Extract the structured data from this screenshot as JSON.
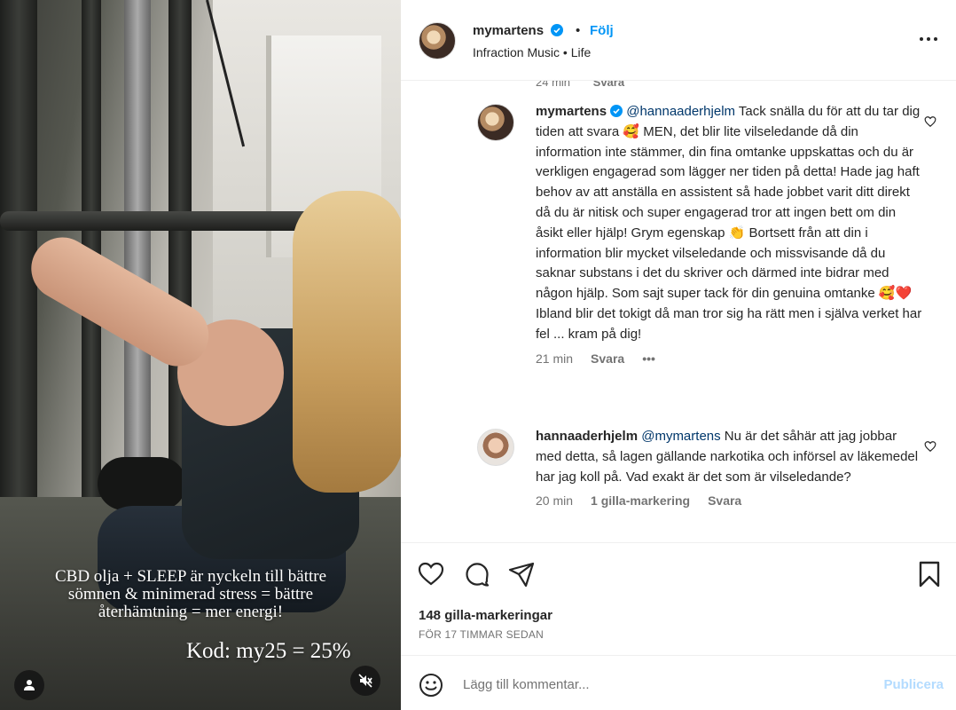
{
  "media": {
    "caption_lines": [
      "CBD olja + SLEEP är nyckeln till bättre",
      "sömnen & minimerad stress = bättre",
      "återhämtning = mer energi!"
    ],
    "code": "Kod: my25 = 25%"
  },
  "header": {
    "username": "mymartens",
    "separator": "•",
    "follow_label": "Följ",
    "subline": "Infraction Music • Life"
  },
  "partial_comment": {
    "time": "24 min",
    "reply_label": "Svara"
  },
  "comments": [
    {
      "username": "mymartens",
      "mention": "@hannaaderhjelm",
      "text_1": " Tack snälla du för att du tar dig tiden att svara ",
      "emoji_1": "🥰",
      "text_2": " MEN, det blir lite vilseledande då din information inte stämmer, din fina omtanke uppskattas och du är verkligen engagerad som lägger ner tiden på detta! Hade jag haft behov av att anställa en assistent så hade jobbet varit ditt direkt då du är nitisk och super engagerad tror att ingen bett om din åsikt eller hjälp! Grym egenskap ",
      "emoji_2": "👏",
      "text_3": " Bortsett från att din i information blir mycket vilseledande och missvisande då du saknar substans i det du skriver och därmed inte bidrar med någon hjälp. Som sajt super tack för din genuina omtanke ",
      "emoji_3": "🥰",
      "emoji_4": "❤️",
      "text_4": " Ibland blir det tokigt då man tror sig ha rätt men i själva verket har fel ... kram på dig!",
      "time": "21 min",
      "reply_label": "Svara",
      "more": "•••"
    },
    {
      "username": "hannaaderhjelm",
      "mention": "@mymartens",
      "text_1": " Nu är det såhär att jag jobbar med detta, så lagen gällande narkotika och införsel av läkemedel har jag koll på. Vad exakt är det som är vilseledande?",
      "time": "20 min",
      "likes": "1 gilla-markering",
      "reply_label": "Svara"
    }
  ],
  "actions": {
    "likes": "148 gilla-markeringar",
    "time_ago": "FÖR 17 TIMMAR SEDAN"
  },
  "add_comment": {
    "placeholder": "Lägg till kommentar...",
    "publish_label": "Publicera"
  },
  "colors": {
    "link_blue": "#0095f6",
    "mention_blue": "#00376b",
    "publish_disabled": "#b3dbff",
    "muted_text": "#737373"
  }
}
